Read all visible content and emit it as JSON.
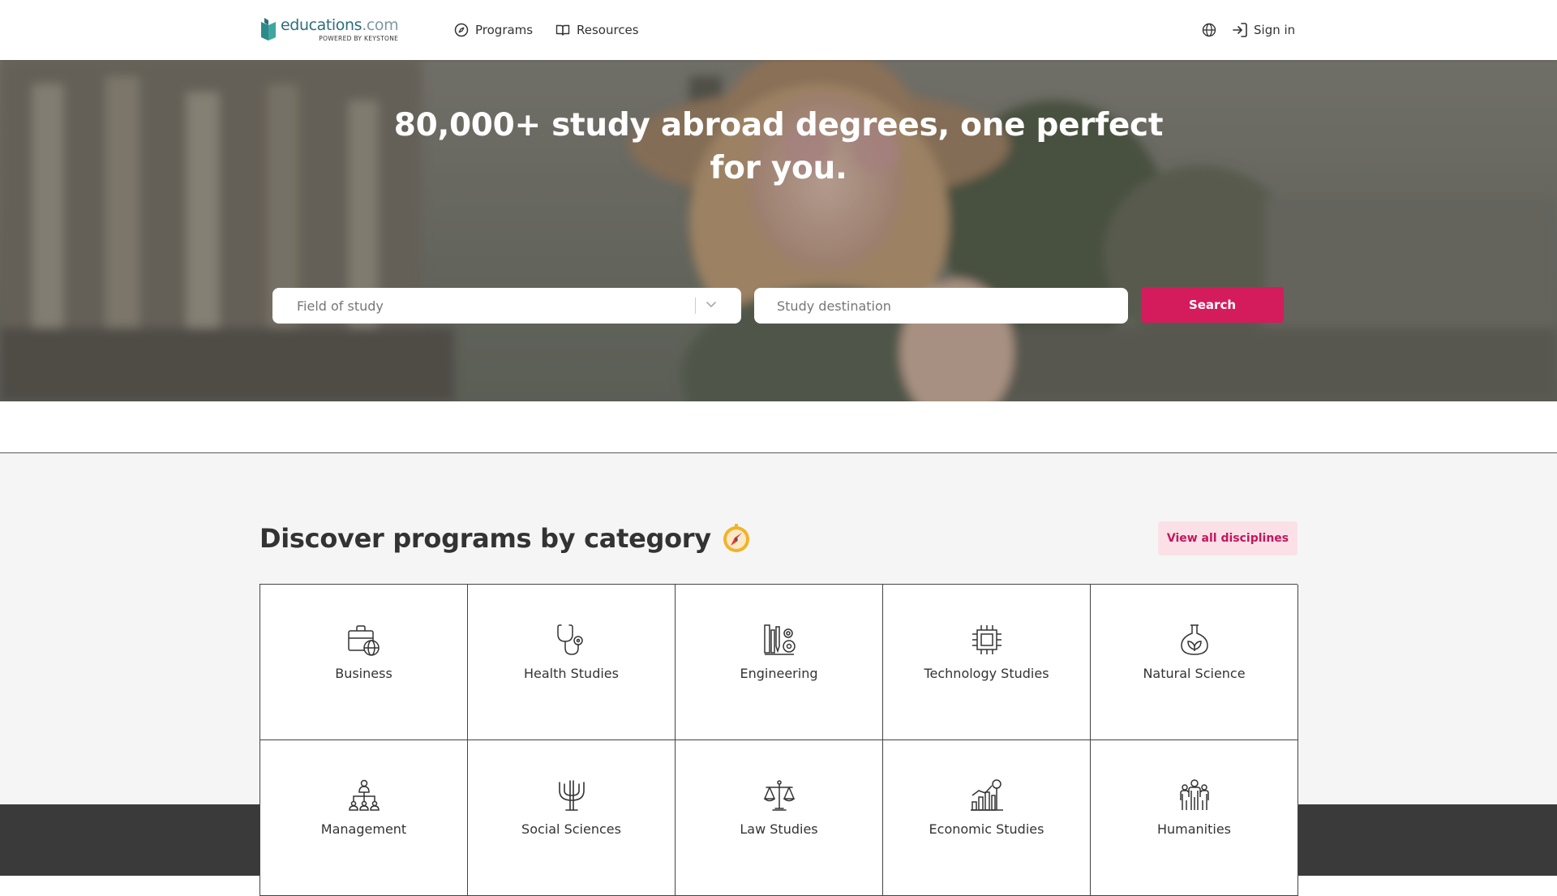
{
  "header": {
    "logo": {
      "name_part1": "educations",
      "name_part2": ".com",
      "tagline": "POWERED BY KEYSTONE"
    },
    "nav": [
      {
        "label": "Programs",
        "icon": "compass-icon"
      },
      {
        "label": "Resources",
        "icon": "book-icon"
      }
    ],
    "language_icon": "globe-icon",
    "signin": {
      "label": "Sign in",
      "icon": "sign-in-icon"
    }
  },
  "hero": {
    "title": "80,000+ study abroad degrees, one perfect for you.",
    "field_placeholder": "Field of study",
    "destination_placeholder": "Study destination",
    "search_label": "Search"
  },
  "categories": {
    "title": "Discover programs by category",
    "title_emoji": "compass-emoji",
    "view_all_label": "View all disciplines",
    "items": [
      {
        "label": "Business",
        "icon": "briefcase-globe-icon"
      },
      {
        "label": "Health Studies",
        "icon": "stethoscope-icon"
      },
      {
        "label": "Engineering",
        "icon": "engineering-tools-icon"
      },
      {
        "label": "Technology Studies",
        "icon": "microchip-icon"
      },
      {
        "label": "Natural Science",
        "icon": "flask-leaf-icon"
      },
      {
        "label": "Management",
        "icon": "org-chart-icon"
      },
      {
        "label": "Social Sciences",
        "icon": "psi-icon"
      },
      {
        "label": "Law Studies",
        "icon": "scales-icon"
      },
      {
        "label": "Economic Studies",
        "icon": "economic-chart-icon"
      },
      {
        "label": "Humanities",
        "icon": "people-icon"
      }
    ]
  },
  "colors": {
    "accent": "#d41c5c",
    "accent_soft": "#fbe0e8",
    "logo_teal": "#2d6e7a",
    "text": "#333333",
    "section_bg": "#f5f5f5",
    "footer_dark": "#3a3a3a"
  }
}
